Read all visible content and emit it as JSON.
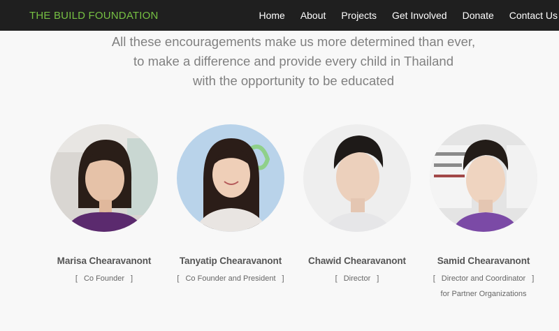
{
  "nav": {
    "brand": "THE BUILD FOUNDATION",
    "links": [
      "Home",
      "About",
      "Projects",
      "Get Involved",
      "Donate",
      "Contact Us"
    ]
  },
  "intro": {
    "lines": [
      "All these encouragements make us more determined than ever,",
      "to make a difference and provide every child in Thailand",
      "with the opportunity to be educated"
    ]
  },
  "team": [
    {
      "name": "Marisa Chearavanont",
      "role": "Co Founder",
      "role2": ""
    },
    {
      "name": "Tanyatip Chearavanont",
      "role": "Co Founder and President",
      "role2": ""
    },
    {
      "name": "Chawid Chearavanont",
      "role": "Director",
      "role2": ""
    },
    {
      "name": "Samid Chearavanont",
      "role": "Director and Coordinator",
      "role2": "for Partner Organizations"
    }
  ],
  "colors": {
    "brand_green": "#76c043",
    "nav_bg": "#1f1f1f",
    "page_bg": "#f8f8f8"
  }
}
